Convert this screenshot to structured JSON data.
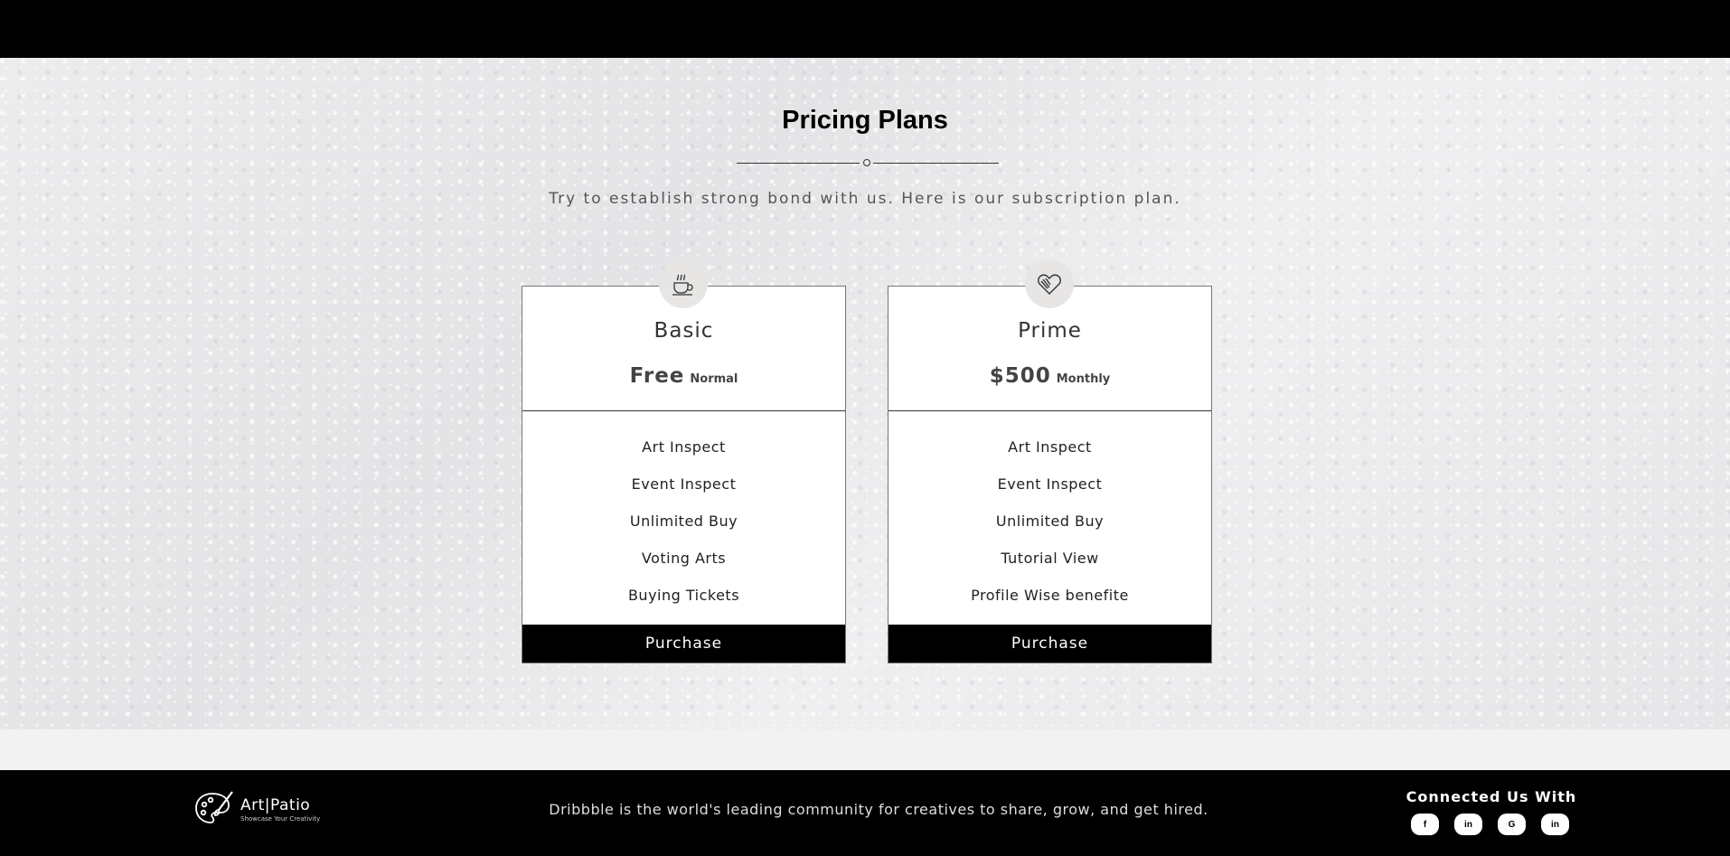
{
  "header": {},
  "pricing": {
    "title": "Pricing Plans",
    "subtitle": "Try to establish strong bond with us. Here is our subscription plan.",
    "plans": [
      {
        "icon": "coffee-cup-icon",
        "name": "Basic",
        "price": "Free",
        "period": "Normal",
        "features": [
          "Art Inspect",
          "Event Inspect",
          "Unlimited Buy",
          "Voting Arts",
          "Buying Tickets"
        ],
        "button": "Purchase"
      },
      {
        "icon": "heart-icon",
        "name": "Prime",
        "price": "$500",
        "period": "Monthly",
        "features": [
          "Art Inspect",
          "Event Inspect",
          "Unlimited Buy",
          "Tutorial View",
          "Profile Wise benefite"
        ],
        "button": "Purchase"
      }
    ]
  },
  "footer": {
    "logo": {
      "name": "Art|Patio",
      "tagline": "Showcase Your Creativity",
      "icon": "palette-icon"
    },
    "description": "Dribbble is the world's leading community for creatives to share, grow, and get hired.",
    "social_title": "Connected Us With",
    "social": [
      {
        "icon": "facebook-icon",
        "glyph": "f"
      },
      {
        "icon": "linkedin-icon",
        "glyph": "in"
      },
      {
        "icon": "google-icon",
        "glyph": "G"
      },
      {
        "icon": "linkedin-icon",
        "glyph": "in"
      }
    ]
  },
  "colors": {
    "header_bg": "#000000",
    "footer_bg": "#000000",
    "button_bg": "#000000",
    "card_bg": "#ffffff"
  }
}
